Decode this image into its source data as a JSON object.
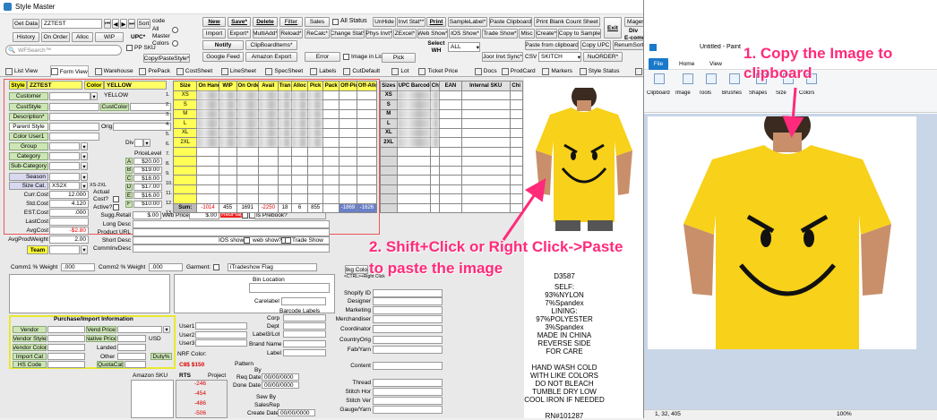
{
  "window": {
    "title": "Style Master"
  },
  "toolbar": {
    "get_data": "Get Data",
    "style_code": "ZZTEST",
    "sort": "Sort",
    "code": "code",
    "all": "All",
    "master": "Master",
    "colors": "Colors",
    "history": "History",
    "on_order": "On Order",
    "alloc": "Alloc",
    "wip": "WIP",
    "upc": "UPC*",
    "pp_sku": "PP SKU",
    "search_placeholder": "WFSearch™",
    "copy_paste_style": "Copy/PasteStyle*",
    "new": "New",
    "save": "Save*",
    "delete": "Delete",
    "filter": "Filter",
    "sales": "Sales",
    "all_status": "All Status",
    "unhide": "UnHide",
    "invt_stat": "Invt Stat**",
    "print": "Print",
    "sample_label": "SampleLabel*",
    "paste_clipboard": "Paste Clipboard",
    "print_blank_count_sheet": "Print Blank Count Sheet",
    "exit": "Exit",
    "magento_export": "Magento Export",
    "import": "Import",
    "export": "Export*",
    "multi_add": "MultiAdd*",
    "reload": "Reload*",
    "recalc": "ReCalc*",
    "change_stat": "Change Stat*",
    "phys_invt": "Phys Invt*",
    "z_excel": "ZExcel*",
    "web_show": "Web Show*",
    "ios_show": "IOS Show*",
    "trade_show": "Trade Show*",
    "misc": "Misc",
    "create": "Create*",
    "copy_to_sample": "Copy to Sample",
    "div": "Div",
    "ecomm": "E-comm",
    "notify": "Notify",
    "clipboard_items": "ClipBoardItems*",
    "select_wh": "Select WH",
    "wh_value": "ALL",
    "paste_from_clipboard": "Paste from clipboard",
    "copy_upc": "Copy UPC",
    "renum_sort": "RenumSort",
    "google_feed": "Google Feed",
    "amazon_export": "Amazon Export",
    "error": "Error",
    "image_in_list": "Image in List",
    "pick": "Pick",
    "joor_invt_sync": "Joor Invt Sync*",
    "csv": "CSV",
    "csv_value": "SKITCH",
    "nu_order": "NuORDER*"
  },
  "tabs": [
    "List View",
    "Form View",
    "Warehouse",
    "PrePack",
    "CostSheet",
    "LineSheet",
    "SpecSheet",
    "Labels",
    "CutDefault",
    "Lot",
    "Ticket Price",
    "Docs",
    "ProdCard",
    "Markers",
    "Style Status",
    "Analytics",
    "LineSheet2"
  ],
  "form": {
    "style_label": "Style",
    "style_value": "ZZTEST",
    "color_label": "Color",
    "color_value": "YELLOW",
    "color_text": "YELLOW",
    "customer": "Customer",
    "cust_style": "CustStyle",
    "cust_color": "CustColor",
    "description": "Description*",
    "parent_style": "Parent Style",
    "orig": "Orig.",
    "color_user1": "Color User1",
    "group": "Group",
    "category": "Category",
    "sub_category": "Sub-Category",
    "season": "Season",
    "size_cat": "Size Cat.",
    "size_cat_value": "XS2X",
    "size_cat_text": "XS-2XL",
    "curr_cost": "Curr.Cost",
    "curr_cost_value": "12.000",
    "std_cost": "Std.Cost",
    "std_cost_value": "4.120",
    "est_cost": "EST.Cost",
    "est_cost_value": ".000",
    "last_cost": "LastCost",
    "avg_cost": "AvgCost",
    "avg_cost_value": "-$2.80",
    "avg_prod_weight": "AvgProdWeight",
    "avg_prod_weight_value": "2.00",
    "team": "Team",
    "actual": "Actual",
    "cost_q": "Cost?",
    "active": "Active?",
    "div": "Div",
    "price_level": "PriceLevel",
    "price_levels": [
      {
        "k": "A",
        "v": "$20.00"
      },
      {
        "k": "B",
        "v": "$19.00"
      },
      {
        "k": "C",
        "v": "$18.00"
      },
      {
        "k": "D",
        "v": "$17.00"
      },
      {
        "k": "E",
        "v": "$16.00"
      },
      {
        "k": "F",
        "v": "$10.00"
      }
    ],
    "sugg_retail": "Sugg.Retail",
    "sugg_retail_value": "$.00",
    "web_price": "Web Price",
    "web_price_value": "$.00",
    "red_flag": "RedFlag",
    "is_prebook": "Is Prebook?",
    "long_desc": "Long Desc",
    "product_url": "Product URL",
    "short_desc": "Short Desc",
    "comminv_desc": "CommInvDesc",
    "ios_show": "IOS show",
    "web_show": "web show?",
    "trade_show": "Trade Show",
    "comm1_weight": "Comm1 % Weight",
    "comm1_value": ".000",
    "comm2_weight": "Comm2 % Weight",
    "comm2_value": ".000",
    "garment": "Garment:",
    "itradeshow_flag": "iTradeshow Flag",
    "bin_location": "Bin Location",
    "carelabel": "Carelabel",
    "barcode_labels": "Barcode Labels",
    "corp": "Corp",
    "dept": "Dept",
    "label_lot": "Label3/Lot",
    "brand_name": "Brand Name",
    "label": "Label",
    "user1": "User1",
    "user2": "User2",
    "user3": "User3",
    "nrf_color": "NRF Color:",
    "cb_price": "C8$ $150",
    "pattern": "Pattern",
    "by": "By",
    "req_date": "Req Date",
    "req_date_value": "00/00/0000",
    "done_date": "Done Date",
    "done_date_value": "00/00/0000",
    "sew_by": "Sew By",
    "sales_rep": "SalesRep",
    "create_date": "Create Date",
    "create_date_value": "00/00/0000",
    "attribute_grid": "Attribute Grid",
    "bkg_color": "Bkg Color",
    "ctrl_hint": "<CTRL>+Right Click",
    "shopify_id": "Shopify ID",
    "designer": "Designer",
    "marketing": "Marketing",
    "merchandiser": "Merchandiser",
    "coordinator": "Coordinator",
    "country_orig": "CountryOrig",
    "fab_yarn": "Fab/Yarn",
    "content": "Content",
    "thread": "Thread",
    "stitch_hor": "Stitch Hor",
    "stitch_ver": "Stitch Ver",
    "gauge_yarn": "Gauge/Yarn",
    "purchase_title": "Purchase/Import Information",
    "vendor": "Vendor",
    "vendor_style": "Vendor Style",
    "vendor_color": "Vendor Color",
    "import_cat": "Import Cat",
    "hs_code": "HS Code",
    "vend_price": "Vend Price",
    "native_price": "Native Price",
    "usd": "USD",
    "landed": "Landed",
    "other": "Other",
    "duty": "Duty%",
    "quota_cat": "QuotaCat",
    "amazon_sku": "Amazon SKU",
    "rts": "RTS",
    "project": "Project",
    "rts_values": [
      "-246",
      "-454",
      "-486",
      "-506"
    ]
  },
  "inventory": {
    "headers": [
      "Size",
      "On Hand",
      "WIP",
      "On Order",
      "Avail",
      "Tran",
      "Alloc",
      "Pick",
      "Pack",
      "Off-Pick",
      "Off-Alloc"
    ],
    "sizes": [
      "XS",
      "S",
      "M",
      "L",
      "XL",
      "2XL"
    ],
    "row_numbers": [
      "1.",
      "2.",
      "3.",
      "4.",
      "5.",
      "6.",
      "7.",
      "8.",
      "9.",
      "10.",
      "11.",
      "12.",
      "13."
    ],
    "sum_label": "Sum:",
    "sums": [
      "-1014",
      "455",
      "1691",
      "-2250",
      "18",
      "6",
      "855",
      "",
      "-1869",
      "-1626"
    ]
  },
  "upc_grid": {
    "headers": [
      "Sizes",
      "UPC Barcode",
      "Chk",
      "EAN",
      "Internal SKU",
      "Chi"
    ],
    "sizes": [
      "XS",
      "S",
      "M",
      "L",
      "XL",
      "2XL"
    ]
  },
  "care_label": {
    "code": "D3587",
    "lines": [
      "SELF:",
      "93%NYLON",
      "7%Spandex",
      "LINING:",
      "97%POLYESTER",
      "3%Spandex",
      "MADE IN CHINA",
      "REVERSE SIDE",
      "FOR CARE",
      "",
      "HAND WASH COLD",
      "WITH LIKE COLORS",
      "DO NOT BLEACH",
      "TUMBLE DRY LOW",
      "COOL IRON IF NEEDED",
      "",
      "RN#101287"
    ]
  },
  "annotations": {
    "step1": "1. Copy the Image to",
    "step1b": "clipboard",
    "step2": "2. Shift+Click or Right Click->Paste",
    "step2b": "to paste the image"
  },
  "paint": {
    "title": "Untitled - Paint",
    "tab_file": "File",
    "tab_home": "Home",
    "tab_view": "View",
    "groups": [
      "Clipboard",
      "Image",
      "Tools",
      "Brushes",
      "Shapes",
      "Size",
      "Colors"
    ],
    "status_left": "1, 32, 405",
    "status_zoom": "100%"
  },
  "colors": {
    "accent_pink": "#ff2a7a",
    "yellow": "#ffff33",
    "green": "#cde6b6",
    "paint_blue": "#1979ca"
  }
}
